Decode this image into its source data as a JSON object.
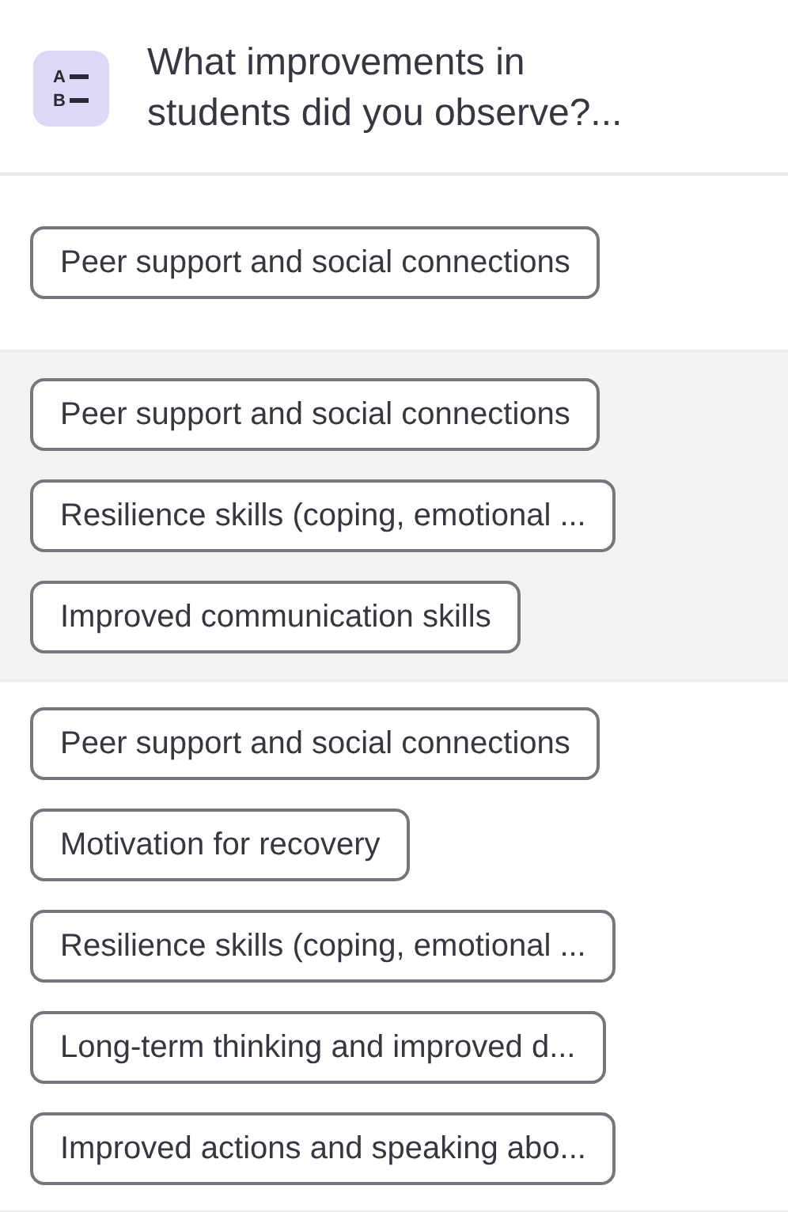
{
  "question": {
    "icon_letters": [
      "A",
      "B"
    ],
    "title": "What improvements in students did you observe?..."
  },
  "responses": [
    {
      "shaded": false,
      "answers": [
        "Peer support and social connections"
      ]
    },
    {
      "shaded": true,
      "answers": [
        "Peer support and social connections",
        "Resilience skills (coping, emotional ...",
        "Improved communication skills"
      ]
    },
    {
      "shaded": false,
      "answers": [
        "Peer support and social connections",
        "Motivation for recovery",
        "Resilience skills (coping, emotional ...",
        "Long-term thinking and improved d...",
        "Improved actions and speaking abo..."
      ]
    }
  ]
}
